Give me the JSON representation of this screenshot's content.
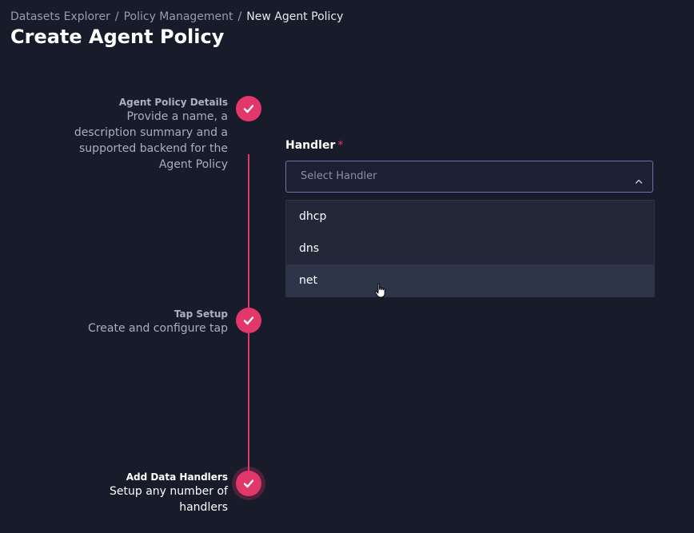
{
  "breadcrumb": {
    "items": [
      "Datasets Explorer",
      "Policy Management"
    ],
    "current": "New Agent Policy",
    "separator": "/"
  },
  "page": {
    "title": "Create Agent Policy"
  },
  "stepper": {
    "accent_color": "#e2376b",
    "steps": [
      {
        "title": "Agent Policy Details",
        "description_lines": [
          "Provide a name, a",
          "description summary and a",
          "supported backend for the",
          "Agent Policy"
        ],
        "status": "complete",
        "icon": "check-icon"
      },
      {
        "title": "Tap Setup",
        "description_lines": [
          "Create and configure tap"
        ],
        "status": "complete",
        "icon": "check-icon"
      },
      {
        "title": "Add Data Handlers",
        "description_lines": [
          "Setup any number of",
          "handlers"
        ],
        "status": "active",
        "icon": "check-icon"
      }
    ]
  },
  "form": {
    "handler": {
      "label": "Handler",
      "required_mark": "*",
      "placeholder": "Select Handler",
      "chevron_icon": "chevron-up-icon",
      "options": [
        "dhcp",
        "dns",
        "net"
      ],
      "hovered_option": "net"
    }
  },
  "colors": {
    "background": "#181b2a",
    "dropdown_bg": "#232839",
    "select_border": "#6b73a8"
  }
}
